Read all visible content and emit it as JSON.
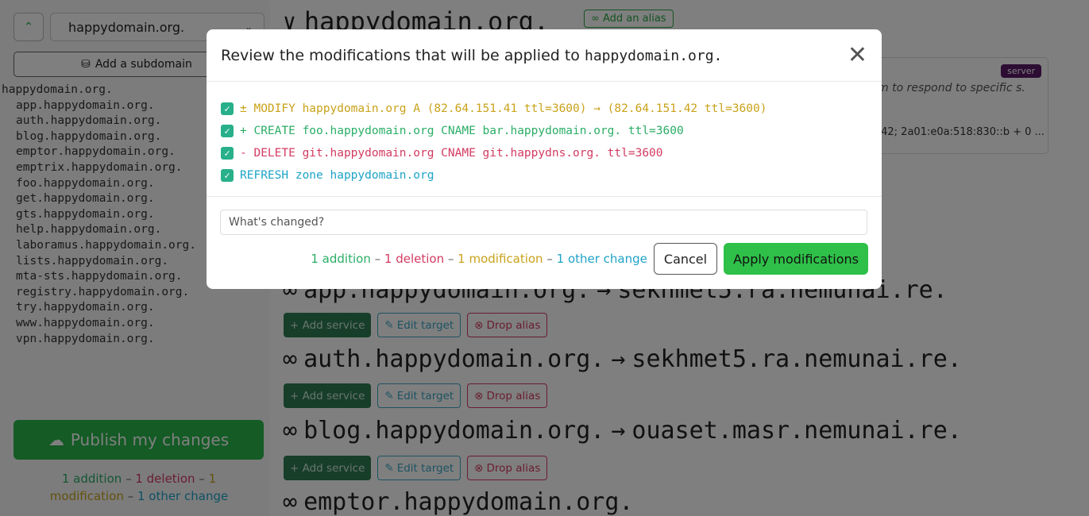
{
  "sidebar": {
    "domain_select_value": "happydomain.org.",
    "add_subdomain_label": "Add a subdomain",
    "domains": [
      "happydomain.org.",
      "app.happydomain.org.",
      "auth.happydomain.org.",
      "blog.happydomain.org.",
      "emptor.happydomain.org.",
      "emptrix.happydomain.org.",
      "foo.happydomain.org.",
      "get.happydomain.org.",
      "gts.happydomain.org.",
      "help.happydomain.org.",
      "laboramus.happydomain.org.",
      "lists.happydomain.org.",
      "mta-sts.happydomain.org.",
      "registry.happydomain.org.",
      "try.happydomain.org.",
      "www.happydomain.org.",
      "vpn.happydomain.org."
    ],
    "publish_label": "Publish my changes",
    "summary": {
      "additions": "1 addition",
      "deletions": "1 deletion",
      "modifications": "1 modification",
      "others": "1 other change",
      "separator": "–"
    }
  },
  "main": {
    "zone_title": "happydomain.org.",
    "add_alias_label": "Add an alias",
    "server_card": {
      "badge": "server",
      "description": "m to respond to specific s.",
      "ips": ".42; 2a01:e0a:518:830::b + 0 ..."
    },
    "aliases": [
      {
        "name": "app.happydomain.org.",
        "target": "sekhmet5.ra.nemunai.re."
      },
      {
        "name": "auth.happydomain.org.",
        "target": "sekhmet5.ra.nemunai.re."
      },
      {
        "name": "blog.happydomain.org.",
        "target": "ouaset.masr.nemunai.re."
      },
      {
        "name": "emptor.happydomain.org.",
        "target": ""
      }
    ],
    "alias_buttons": {
      "add_service": "+ Add service",
      "edit_target": "Edit target",
      "drop_alias": "Drop alias"
    }
  },
  "modal": {
    "title_prefix": "Review the modifications that will be applied to",
    "title_domain": "happydomain.org.",
    "changes": [
      {
        "text": "± MODIFY happydomain.org A (82.64.151.41 ttl=3600) → (82.64.151.42 ttl=3600)",
        "color": "#c9a21a"
      },
      {
        "text": "+ CREATE foo.happydomain.org CNAME bar.happydomain.org. ttl=3600",
        "color": "#2bae66"
      },
      {
        "text": "- DELETE git.happydomain.org CNAME git.happydns.org. ttl=3600",
        "color": "#d33b62"
      },
      {
        "text": "REFRESH zone happydomain.org",
        "color": "#1ea3c7"
      }
    ],
    "message_placeholder": "What's changed?",
    "summary": {
      "additions": "1 addition",
      "deletions": "1 deletion",
      "modifications": "1 modification",
      "others": "1 other change",
      "separator": "–"
    },
    "cancel_label": "Cancel",
    "apply_label": "Apply modifications"
  }
}
